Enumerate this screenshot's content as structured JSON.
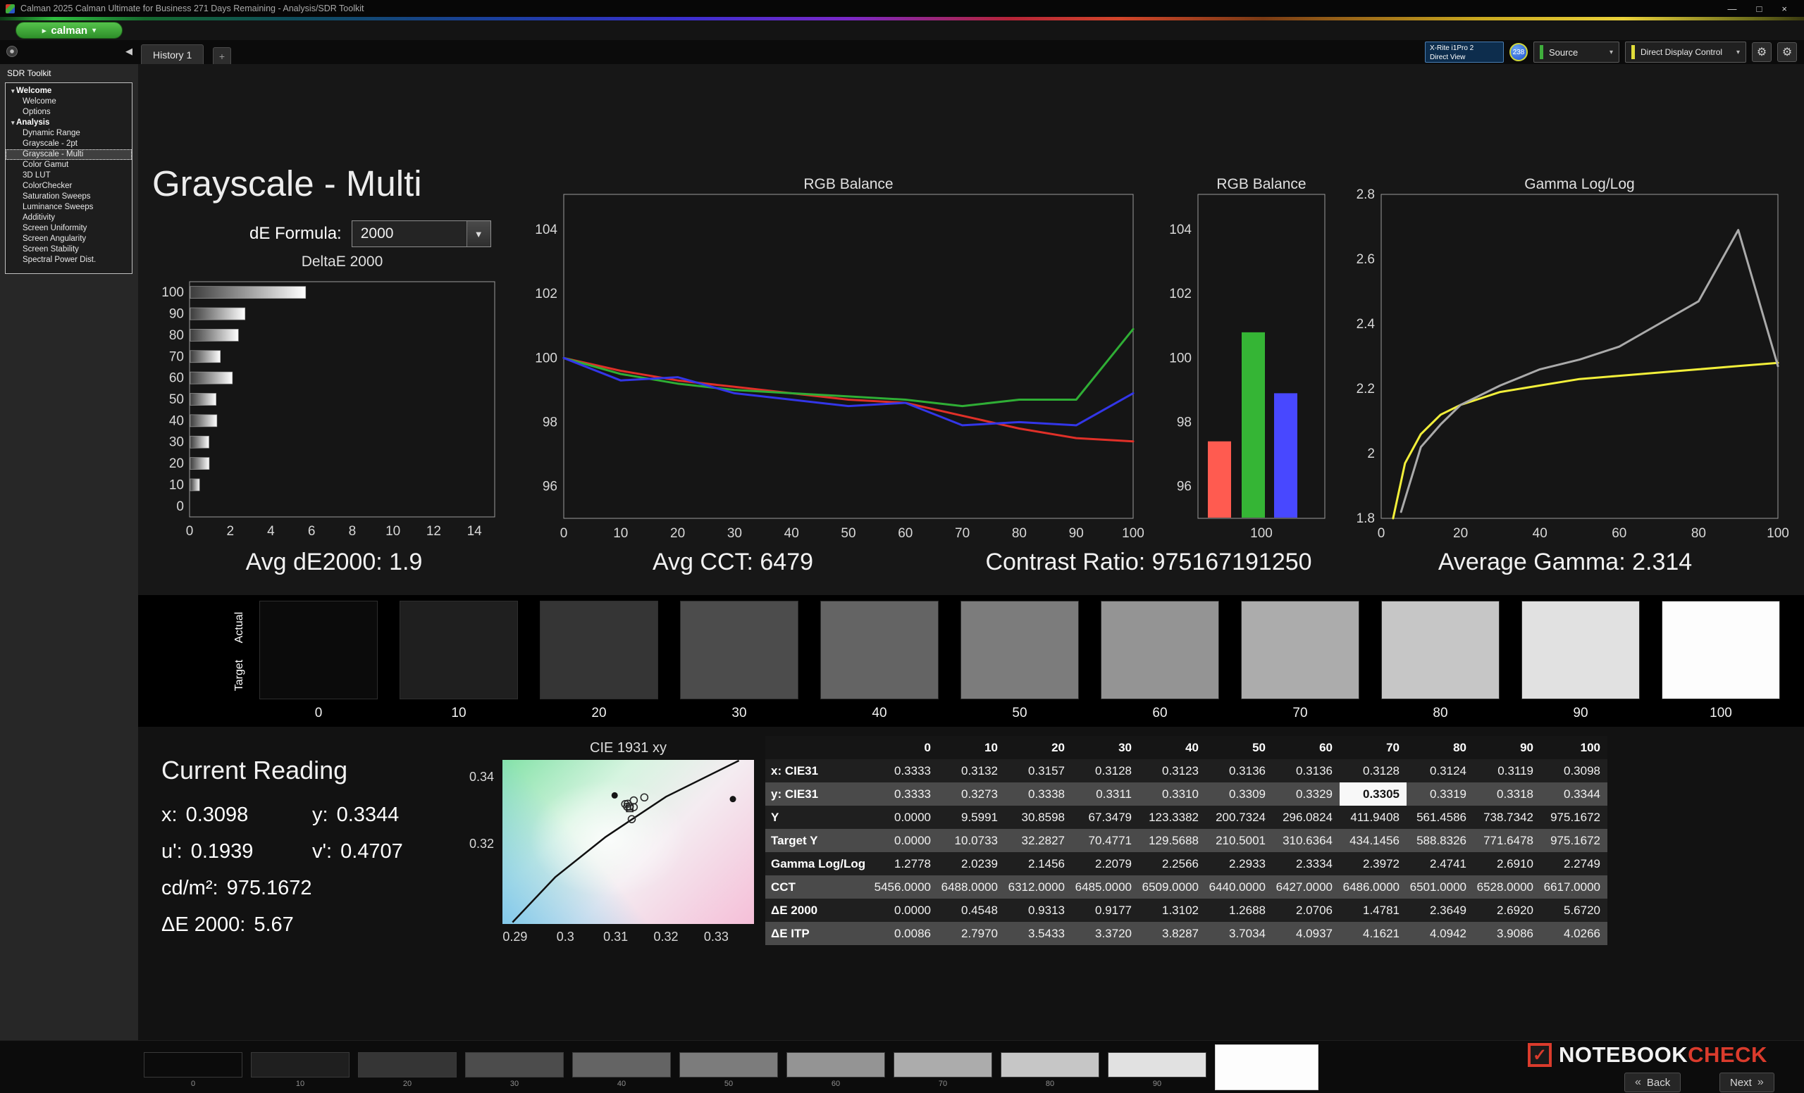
{
  "window": {
    "title": "Calman 2025 Calman Ultimate for Business 271 Days Remaining  - Analysis/SDR Toolkit",
    "logo_text": "calman",
    "tab_label": "History 1",
    "meter_line1": "X-Rite i1Pro 2",
    "meter_line2": "Direct View",
    "meter_badge": "238",
    "source_label": "Source",
    "display_control_label": "Direct Display Control"
  },
  "sidebar": {
    "title": "SDR Toolkit",
    "tree": [
      {
        "label": "Welcome",
        "group": true
      },
      {
        "label": "Welcome"
      },
      {
        "label": "Options"
      },
      {
        "label": "Analysis",
        "group": true
      },
      {
        "label": "Dynamic Range"
      },
      {
        "label": "Grayscale - 2pt"
      },
      {
        "label": "Grayscale - Multi",
        "selected": true
      },
      {
        "label": "Color Gamut"
      },
      {
        "label": "3D LUT"
      },
      {
        "label": "ColorChecker"
      },
      {
        "label": "Saturation Sweeps"
      },
      {
        "label": "Luminance Sweeps"
      },
      {
        "label": "Additivity"
      },
      {
        "label": "Screen Uniformity"
      },
      {
        "label": "Screen Angularity"
      },
      {
        "label": "Screen Stability"
      },
      {
        "label": "Spectral Power Dist."
      }
    ]
  },
  "page": {
    "title": "Grayscale - Multi",
    "de_formula_label": "dE Formula:",
    "de_formula_value": "2000"
  },
  "stats": {
    "avg_de": "Avg dE2000: 1.9",
    "avg_cct": "Avg CCT: 6479",
    "contrast": "Contrast Ratio: 975167191250",
    "avg_gamma": "Average Gamma: 2.314"
  },
  "swatches": {
    "actual_label": "Actual",
    "target_label": "Target",
    "labels": [
      "0",
      "10",
      "20",
      "30",
      "40",
      "50",
      "60",
      "70",
      "80",
      "90",
      "100"
    ],
    "colors": [
      "#0b0b0b",
      "#1f1f1f",
      "#353535",
      "#4c4c4c",
      "#646464",
      "#7c7c7c",
      "#949494",
      "#acacac",
      "#c6c6c6",
      "#e1e1e1",
      "#fdfdfd"
    ]
  },
  "current_reading": {
    "title": "Current Reading",
    "x_label": "x:",
    "x_value": "0.3098",
    "y_label": "y:",
    "y_value": "0.3344",
    "u_label": "u':",
    "u_value": "0.1939",
    "v_label": "v':",
    "v_value": "0.4707",
    "cd_label": "cd/m²:",
    "cd_value": "975.1672",
    "de_label": "ΔE 2000:",
    "de_value": "5.67"
  },
  "table": {
    "columns": [
      "0",
      "10",
      "20",
      "30",
      "40",
      "50",
      "60",
      "70",
      "80",
      "90",
      "100"
    ],
    "rows": [
      {
        "label": "x: CIE31",
        "values": [
          "0.3333",
          "0.3132",
          "0.3157",
          "0.3128",
          "0.3123",
          "0.3136",
          "0.3136",
          "0.3128",
          "0.3124",
          "0.3119",
          "0.3098"
        ]
      },
      {
        "label": "y: CIE31",
        "values": [
          "0.3333",
          "0.3273",
          "0.3338",
          "0.3311",
          "0.3310",
          "0.3309",
          "0.3329",
          "0.3305",
          "0.3319",
          "0.3318",
          "0.3344"
        ]
      },
      {
        "label": "Y",
        "values": [
          "0.0000",
          "9.5991",
          "30.8598",
          "67.3479",
          "123.3382",
          "200.7324",
          "296.0824",
          "411.9408",
          "561.4586",
          "738.7342",
          "975.1672"
        ]
      },
      {
        "label": "Target Y",
        "values": [
          "0.0000",
          "10.0733",
          "32.2827",
          "70.4771",
          "129.5688",
          "210.5001",
          "310.6364",
          "434.1456",
          "588.8326",
          "771.6478",
          "975.1672"
        ]
      },
      {
        "label": "Gamma Log/Log",
        "values": [
          "1.2778",
          "2.0239",
          "2.1456",
          "2.2079",
          "2.2566",
          "2.2933",
          "2.3334",
          "2.3972",
          "2.4741",
          "2.6910",
          "2.2749"
        ]
      },
      {
        "label": "CCT",
        "values": [
          "5456.0000",
          "6488.0000",
          "6312.0000",
          "6485.0000",
          "6509.0000",
          "6440.0000",
          "6427.0000",
          "6486.0000",
          "6501.0000",
          "6528.0000",
          "6617.0000"
        ]
      },
      {
        "label": "ΔE 2000",
        "values": [
          "0.0000",
          "0.4548",
          "0.9313",
          "0.9177",
          "1.3102",
          "1.2688",
          "2.0706",
          "1.4781",
          "2.3649",
          "2.6920",
          "5.6720"
        ]
      },
      {
        "label": "ΔE ITP",
        "values": [
          "0.0086",
          "2.7970",
          "3.5433",
          "3.3720",
          "3.8287",
          "3.7034",
          "4.0937",
          "4.1621",
          "4.0942",
          "3.9086",
          "4.0266"
        ]
      }
    ],
    "highlight": {
      "row": 1,
      "col": 7
    }
  },
  "bottom": {
    "watermark_part1": "NOTEBOOK",
    "watermark_part2": "CHECK",
    "back_label": "Back",
    "next_label": "Next",
    "selected_patch": "100"
  },
  "chart_data": [
    {
      "id": "deltae",
      "type": "bar",
      "orientation": "horizontal",
      "title": "DeltaE 2000",
      "categories": [
        "0",
        "10",
        "20",
        "30",
        "40",
        "50",
        "60",
        "70",
        "80",
        "90",
        "100"
      ],
      "values": [
        0.0,
        0.4548,
        0.9313,
        0.9177,
        1.3102,
        1.2688,
        2.0706,
        1.4781,
        2.3649,
        2.692,
        5.672
      ],
      "xlim": [
        0,
        15
      ],
      "xticks": [
        0,
        2,
        4,
        6,
        8,
        10,
        12,
        14
      ]
    },
    {
      "id": "rgb-balance-line",
      "type": "line",
      "title": "RGB Balance",
      "x": [
        0,
        10,
        20,
        30,
        40,
        50,
        60,
        70,
        80,
        90,
        100
      ],
      "series": [
        {
          "name": "Red",
          "color": "#e03028",
          "values": [
            100,
            99.6,
            99.3,
            99.1,
            98.9,
            98.7,
            98.6,
            98.2,
            97.8,
            97.5,
            97.4
          ]
        },
        {
          "name": "Green",
          "color": "#2fae35",
          "values": [
            100,
            99.5,
            99.2,
            99.0,
            98.9,
            98.8,
            98.7,
            98.5,
            98.7,
            98.7,
            100.9
          ]
        },
        {
          "name": "Blue",
          "color": "#3336e8",
          "values": [
            100,
            99.3,
            99.4,
            98.9,
            98.7,
            98.5,
            98.6,
            97.9,
            98.0,
            97.9,
            98.9
          ]
        }
      ],
      "xlim": [
        0,
        100
      ],
      "ylim": [
        95,
        105.1
      ],
      "yticks": [
        96,
        98,
        100,
        102,
        104
      ],
      "xticks": [
        0,
        10,
        20,
        30,
        40,
        50,
        60,
        70,
        80,
        90,
        100
      ]
    },
    {
      "id": "rgb-balance-bar",
      "type": "bar",
      "title": "RGB Balance",
      "categories": [
        "Red",
        "Green",
        "Blue"
      ],
      "colors": [
        "#ff5b50",
        "#35b535",
        "#4848ff"
      ],
      "values": [
        97.4,
        100.8,
        98.9
      ],
      "ylim": [
        95,
        105.1
      ],
      "yticks": [
        96,
        98,
        100,
        102,
        104
      ],
      "xlabel_tick": "100"
    },
    {
      "id": "gamma-loglog",
      "type": "line",
      "title": "Gamma Log/Log",
      "series": [
        {
          "name": "Target",
          "color": "#f2ef3a",
          "x": [
            3,
            6,
            10,
            15,
            20,
            30,
            40,
            50,
            60,
            70,
            80,
            90,
            100
          ],
          "values": [
            1.8,
            1.97,
            2.06,
            2.12,
            2.15,
            2.19,
            2.21,
            2.23,
            2.24,
            2.25,
            2.26,
            2.27,
            2.28
          ]
        },
        {
          "name": "Measured",
          "color": "#aaaaaa",
          "x": [
            5,
            10,
            15,
            20,
            30,
            40,
            50,
            60,
            70,
            80,
            90,
            100
          ],
          "values": [
            1.82,
            2.02,
            2.09,
            2.15,
            2.21,
            2.26,
            2.29,
            2.33,
            2.4,
            2.47,
            2.69,
            2.27
          ]
        }
      ],
      "xlim": [
        0,
        100
      ],
      "ylim": [
        1.8,
        2.8
      ],
      "yticks": [
        1.8,
        2,
        2.2,
        2.4,
        2.6,
        2.8
      ],
      "xticks": [
        0,
        20,
        40,
        60,
        80,
        100
      ]
    },
    {
      "id": "cie-1931",
      "type": "scatter",
      "title": "CIE 1931 xy",
      "xlim": [
        0.2875,
        0.3375
      ],
      "ylim": [
        0.296,
        0.345
      ],
      "xticks": [
        0.29,
        0.3,
        0.31,
        0.32,
        0.33
      ],
      "yticks": [
        0.32,
        0.34
      ],
      "points": [
        {
          "x": 0.3132,
          "y": 0.3273,
          "marker": "open"
        },
        {
          "x": 0.3157,
          "y": 0.3338,
          "marker": "open"
        },
        {
          "x": 0.3128,
          "y": 0.3311,
          "marker": "open"
        },
        {
          "x": 0.3123,
          "y": 0.331,
          "marker": "open"
        },
        {
          "x": 0.3136,
          "y": 0.3309,
          "marker": "open"
        },
        {
          "x": 0.3136,
          "y": 0.3329,
          "marker": "open"
        },
        {
          "x": 0.3128,
          "y": 0.3305,
          "marker": "square"
        },
        {
          "x": 0.3124,
          "y": 0.3319,
          "marker": "open"
        },
        {
          "x": 0.3119,
          "y": 0.3318,
          "marker": "open"
        },
        {
          "x": 0.3098,
          "y": 0.3344,
          "marker": "filled"
        },
        {
          "x": 0.3333,
          "y": 0.3333,
          "marker": "filled"
        }
      ],
      "locus": [
        [
          0.2895,
          0.2965
        ],
        [
          0.298,
          0.31
        ],
        [
          0.308,
          0.322
        ],
        [
          0.32,
          0.334
        ],
        [
          0.3345,
          0.3448
        ]
      ]
    }
  ]
}
